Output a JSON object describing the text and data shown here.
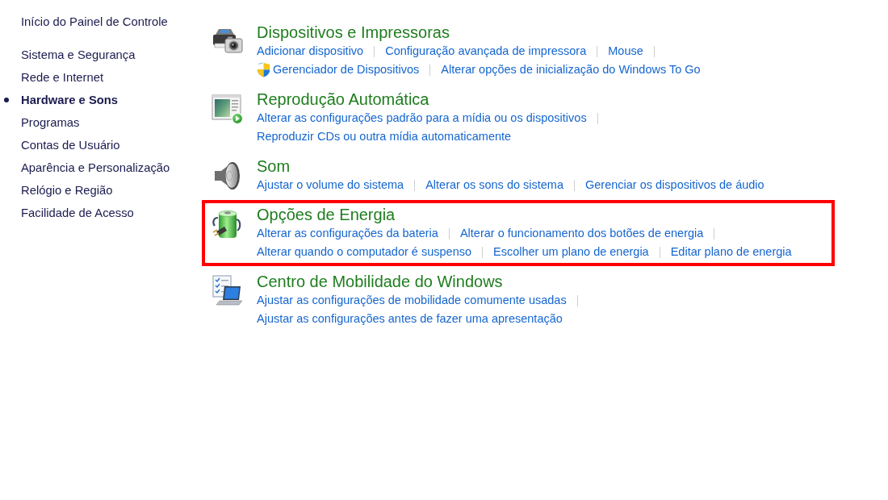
{
  "sidebar": {
    "home_link": "Início do Painel de Controle",
    "items": [
      {
        "label": "Sistema e Segurança",
        "selected": false
      },
      {
        "label": "Rede e Internet",
        "selected": false
      },
      {
        "label": "Hardware e Sons",
        "selected": true
      },
      {
        "label": "Programas",
        "selected": false
      },
      {
        "label": "Contas de Usuário",
        "selected": false
      },
      {
        "label": "Aparência e Personalização",
        "selected": false
      },
      {
        "label": "Relógio e Região",
        "selected": false
      },
      {
        "label": "Facilidade de Acesso",
        "selected": false
      }
    ]
  },
  "categories": [
    {
      "title": "Dispositivos e Impressoras",
      "highlighted": false,
      "rows": [
        [
          {
            "label": "Adicionar dispositivo",
            "kind": "plain"
          },
          {
            "label": "Configuração avançada de impressora",
            "kind": "plain"
          },
          {
            "label": "Mouse",
            "kind": "plain"
          }
        ],
        [
          {
            "label": "Gerenciador de Dispositivos",
            "kind": "admin"
          },
          {
            "label": "Alterar opções de inicialização do Windows To Go",
            "kind": "plain"
          }
        ]
      ]
    },
    {
      "title": "Reprodução Automática",
      "highlighted": false,
      "rows": [
        [
          {
            "label": "Alterar as configurações padrão para a mídia ou os dispositivos",
            "kind": "plain"
          }
        ],
        [
          {
            "label": "Reproduzir CDs ou outra mídia automaticamente",
            "kind": "plain"
          }
        ]
      ]
    },
    {
      "title": "Som",
      "highlighted": false,
      "rows": [
        [
          {
            "label": "Ajustar o volume do sistema",
            "kind": "plain"
          },
          {
            "label": "Alterar os sons do sistema",
            "kind": "plain"
          },
          {
            "label": "Gerenciar os dispositivos de áudio",
            "kind": "plain"
          }
        ]
      ]
    },
    {
      "title": "Opções de Energia",
      "highlighted": true,
      "rows": [
        [
          {
            "label": "Alterar as configurações da bateria",
            "kind": "plain"
          },
          {
            "label": "Alterar o funcionamento dos botões de energia",
            "kind": "plain"
          }
        ],
        [
          {
            "label": "Alterar quando o computador é suspenso",
            "kind": "plain"
          },
          {
            "label": "Escolher um plano de energia",
            "kind": "plain"
          },
          {
            "label": "Editar plano de energia",
            "kind": "plain"
          }
        ]
      ]
    },
    {
      "title": "Centro de Mobilidade do Windows",
      "highlighted": false,
      "rows": [
        [
          {
            "label": "Ajustar as configurações de mobilidade comumente usadas",
            "kind": "plain"
          }
        ],
        [
          {
            "label": "Ajustar as configurações antes de fazer uma apresentação",
            "kind": "plain"
          }
        ]
      ]
    }
  ]
}
